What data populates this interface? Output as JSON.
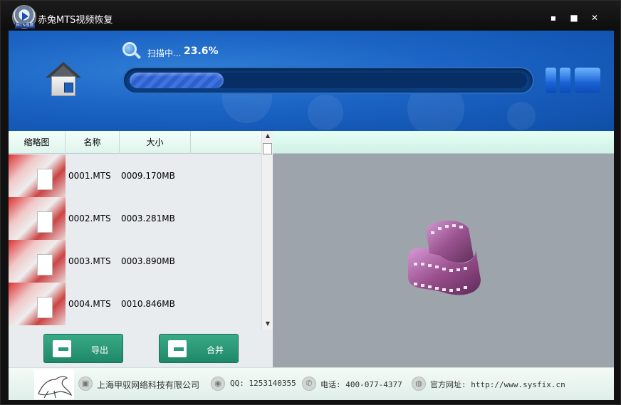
{
  "window": {
    "title": "赤兔MTS视频恢复",
    "logo_tag": "MTS视频",
    "minimize": "▪",
    "maximize": "■",
    "close": "✕"
  },
  "scan": {
    "label": "扫描中...",
    "percent_text": "23.6%",
    "progress": 0.236
  },
  "list": {
    "columns": [
      "缩略图",
      "名称",
      "大小"
    ],
    "rows": [
      {
        "name": "0001.MTS",
        "size": "0009.170MB"
      },
      {
        "name": "0002.MTS",
        "size": "0003.281MB"
      },
      {
        "name": "0003.MTS",
        "size": "0003.890MB"
      },
      {
        "name": "0004.MTS",
        "size": "0010.846MB"
      }
    ]
  },
  "actions": {
    "export_label": "导出",
    "merge_label": "合并"
  },
  "footer": {
    "company": "上海甲驭网络科技有限公司",
    "qq": "QQ: 1253140355",
    "phone": "电话: 400-077-4377",
    "website": "官方网址: http://www.sysfix.cn"
  },
  "icons": {
    "home": "home-icon",
    "search": "search-icon",
    "pause": "pause-icon",
    "stop": "stop-icon",
    "film": "film-reel-icon"
  },
  "colors": {
    "header_blue": "#1b63c4",
    "button_green": "#2a9a7a",
    "preview_gray": "#9ea4ab"
  }
}
